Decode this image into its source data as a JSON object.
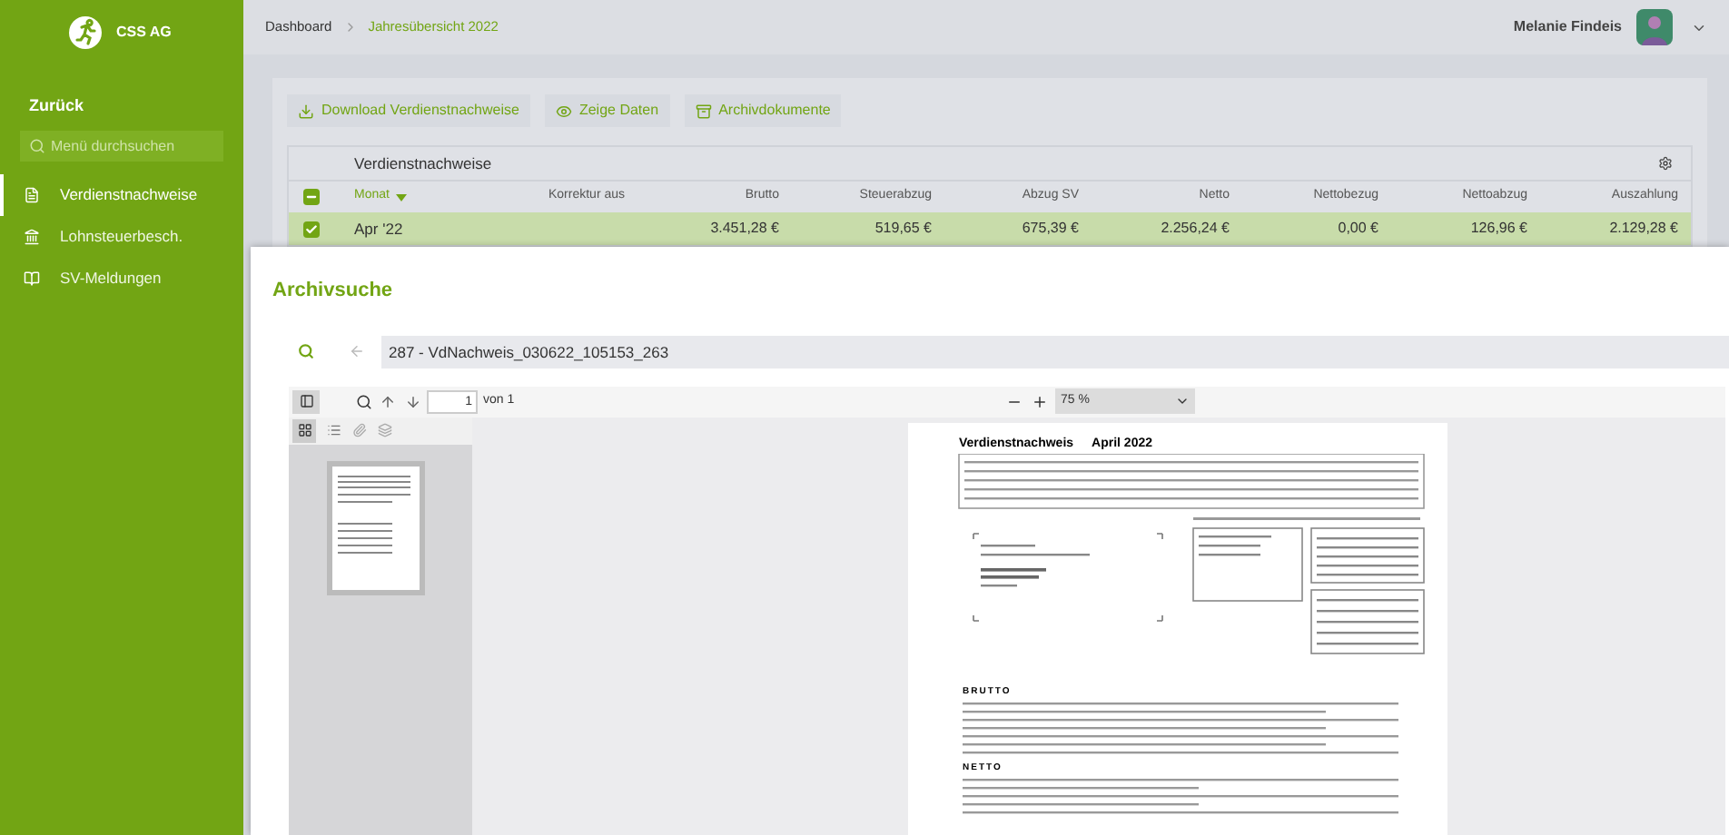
{
  "logo": {
    "text": "CSS AG"
  },
  "sidebar": {
    "back": "Zurück",
    "search_placeholder": "Menü durchsuchen",
    "items": [
      {
        "label": "Verdienstnachweise",
        "selected": true
      },
      {
        "label": "Lohnsteuerbesch.",
        "selected": false
      },
      {
        "label": "SV-Meldungen",
        "selected": false
      }
    ]
  },
  "breadcrumb": [
    "Dashboard",
    "Jahresübersicht 2022"
  ],
  "user": {
    "name": "Melanie Findeis"
  },
  "actions": [
    {
      "label": "Download Verdienstnachweise"
    },
    {
      "label": "Zeige Daten"
    },
    {
      "label": "Archivdokumente"
    }
  ],
  "table": {
    "title": "Verdienstnachweise",
    "select_all": {
      "checked": true,
      "indeterminate": true
    },
    "columns": [
      {
        "label": "Monat",
        "sorted": true
      },
      {
        "label": "Korrektur aus",
        "sorted": false
      },
      {
        "label": "Brutto",
        "sorted": false
      },
      {
        "label": "Steuerabzug",
        "sorted": false
      },
      {
        "label": "Abzug SV",
        "sorted": false
      },
      {
        "label": "Netto",
        "sorted": false
      },
      {
        "label": "Nettobezug",
        "sorted": false
      },
      {
        "label": "Nettoabzug",
        "sorted": false
      },
      {
        "label": "Auszahlung",
        "sorted": false
      }
    ],
    "rows": [
      {
        "checked": true,
        "selected": true,
        "cells": [
          "Apr '22",
          null,
          "3.451,28 €",
          "519,65 €",
          "675,39 €",
          "2.256,24 €",
          "0,00 €",
          "126,96 €",
          "2.129,28 €"
        ]
      }
    ]
  },
  "modal": {
    "title": "Archivsuche",
    "search_value": "287 - VdNachweis_030622_105153_263",
    "viewer": {
      "page": "1",
      "page_total": "von 1",
      "zoom": "75 %"
    },
    "document": {
      "title": "Verdienstnachweis",
      "period": "April 2022",
      "sections": [
        "BRUTTO",
        "NETTO"
      ]
    }
  }
}
